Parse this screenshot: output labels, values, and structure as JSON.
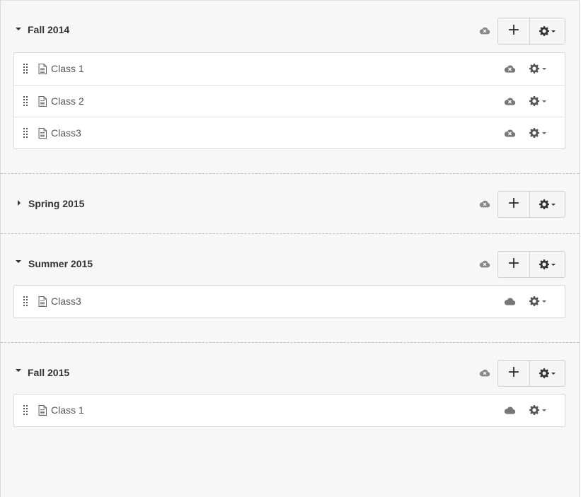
{
  "modules": [
    {
      "title": "Fall 2014",
      "expanded": true,
      "items": [
        {
          "title": "Class 1",
          "published": false
        },
        {
          "title": "Class 2",
          "published": false
        },
        {
          "title": "Class3",
          "published": false
        }
      ]
    },
    {
      "title": "Spring 2015",
      "expanded": false,
      "items": []
    },
    {
      "title": "Summer 2015",
      "expanded": true,
      "items": [
        {
          "title": "Class3",
          "published": true
        }
      ]
    },
    {
      "title": "Fall 2015",
      "expanded": true,
      "items": [
        {
          "title": "Class 1",
          "published": true
        }
      ]
    }
  ],
  "icons": {
    "add": "plus-icon",
    "settings": "gear-icon",
    "unpublished": "cloud-x-icon",
    "published": "cloud-icon",
    "drag": "drag-handle-icon",
    "document": "document-icon"
  },
  "colors": {
    "background": "#f7f7f7",
    "icon": "#777777",
    "text": "#333333"
  }
}
